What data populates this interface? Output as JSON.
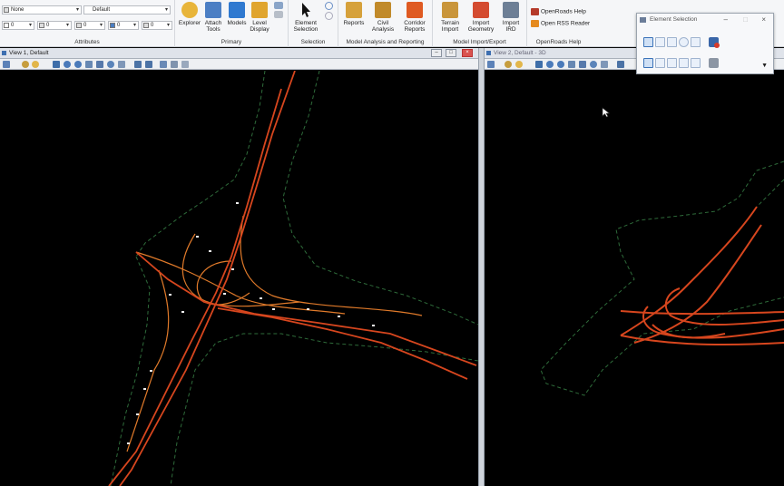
{
  "ribbon": {
    "attributes": {
      "label": "Attributes",
      "level_value": "None",
      "style_value": "Default",
      "color_value": "0",
      "linestyle_value": "0",
      "weight_value": "0",
      "transparency_value": "0",
      "priority_value": "0"
    },
    "primary": {
      "label": "Primary",
      "explorer": "Explorer",
      "attach_tools": "Attach Tools",
      "models": "Models",
      "level_display": "Level Display"
    },
    "selection": {
      "label": "Selection",
      "element_selection": "Element Selection"
    },
    "model_analysis": {
      "label": "Model Analysis and Reporting",
      "reports": "Reports",
      "civil_analysis": "Civil Analysis",
      "corridor_reports": "Corridor Reports"
    },
    "model_import": {
      "label": "Model Import/Export",
      "terrain_import": "Terrain Import",
      "import_geometry": "Import Geometry",
      "import_ird": "Import IRD"
    },
    "help": {
      "label": "OpenRoads Help",
      "openroads_help": "OpenRoads Help",
      "open_rss_reader": "Open RSS Reader"
    }
  },
  "views": {
    "view1_title": "View 1, Default",
    "view2_title": "View 2, Default - 3D"
  },
  "element_selection_dialog": {
    "title": "Element Selection"
  },
  "colors": {
    "alignment": "#d7461e",
    "alignment_light": "#e07a2a",
    "boundary": "#2e6b3a",
    "canvas": "#000000"
  }
}
